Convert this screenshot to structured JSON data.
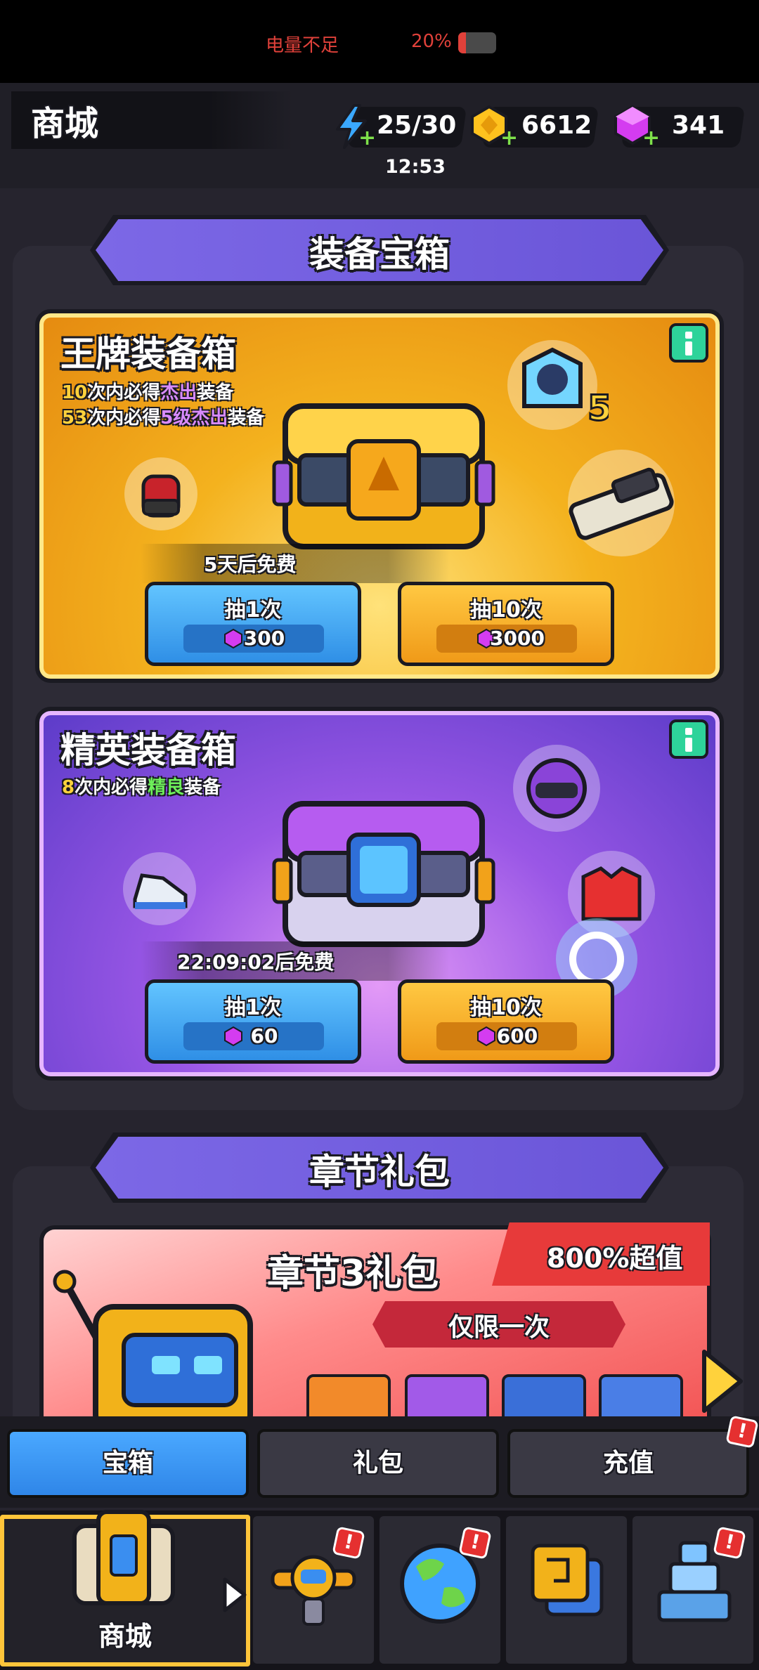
{
  "status_bar": {
    "battery_warning": "电量不足",
    "battery_percent": "20%",
    "battery_level": 0.2
  },
  "header": {
    "title": "商城",
    "energy": "25/30",
    "energy_timer": "12:53",
    "coins": "6612",
    "gems": "341"
  },
  "equipment_section": {
    "title": "装备宝箱",
    "ace_chest": {
      "title": "王牌装备箱",
      "line1": {
        "prefix": "10",
        "mid": "次内必得",
        "highlight": "杰出",
        "suffix": "装备"
      },
      "line2": {
        "prefix": "53",
        "mid": "次内必得",
        "highlight": "5级杰出",
        "suffix": "装备"
      },
      "free_text": "5天后免费",
      "single": {
        "label": "抽1次",
        "price": "300"
      },
      "ten": {
        "label": "抽10次",
        "price": "3000"
      },
      "reward_level": "5"
    },
    "elite_chest": {
      "title": "精英装备箱",
      "line1": {
        "prefix": "8",
        "mid": "次内必得",
        "highlight": "精良",
        "suffix": "装备"
      },
      "free_text": "22:09:02后免费",
      "single": {
        "label": "抽1次",
        "price": "60"
      },
      "ten": {
        "label": "抽10次",
        "price": "600"
      }
    }
  },
  "chapter_section": {
    "title": "章节礼包",
    "pack": {
      "title": "章节3礼包",
      "value_tag": "800%超值",
      "limit": "仅限一次"
    }
  },
  "tabs": [
    {
      "label": "宝箱",
      "active": true
    },
    {
      "label": "礼包",
      "active": false
    },
    {
      "label": "充值",
      "active": false,
      "badge": "!"
    }
  ],
  "bottom_nav": [
    {
      "label": "商城",
      "icon": "shop-chest-icon",
      "active": true
    },
    {
      "label": "",
      "icon": "plane-robot-icon",
      "badge": "!"
    },
    {
      "label": "",
      "icon": "world-globe-icon",
      "badge": "!"
    },
    {
      "label": "",
      "icon": "map-tile-icon"
    },
    {
      "label": "",
      "icon": "base-tower-icon",
      "badge": "!"
    }
  ],
  "colors": {
    "gold_card": "#f4b21e",
    "purple_card": "#9a57e6",
    "button_blue": "#2f8fe6",
    "button_orange": "#f09a18",
    "accent_green": "#2ed39a"
  }
}
